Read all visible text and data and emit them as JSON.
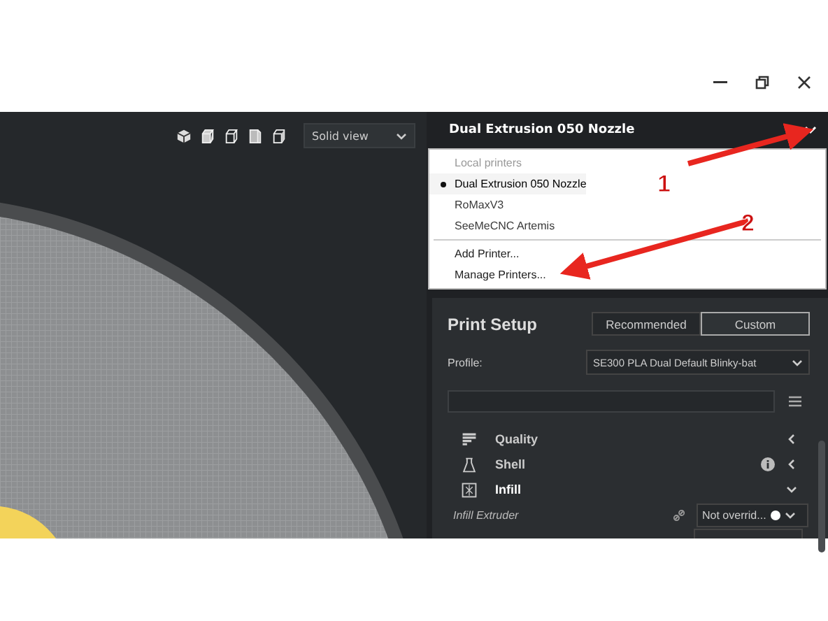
{
  "viewport": {
    "view_mode": "Solid view"
  },
  "printer_selector": {
    "current": "Dual Extrusion 050 Nozzle",
    "expanded": true,
    "menu": [
      {
        "kind": "header",
        "label": "Local printers"
      },
      {
        "kind": "printer",
        "label": "Dual Extrusion 050 Nozzle",
        "selected": true
      },
      {
        "kind": "printer",
        "label": "RoMaxV3",
        "selected": false
      },
      {
        "kind": "printer",
        "label": "SeeMeCNC Artemis",
        "selected": false
      },
      {
        "kind": "divider"
      },
      {
        "kind": "action",
        "label": "Add Printer..."
      },
      {
        "kind": "action",
        "label": "Manage Printers..."
      }
    ]
  },
  "annotations": [
    {
      "label": "1"
    },
    {
      "label": "2"
    }
  ],
  "print_setup": {
    "title": "Print Setup",
    "tabs": [
      {
        "label": "Recommended",
        "selected": false
      },
      {
        "label": "Custom",
        "selected": true
      }
    ],
    "profile_label": "Profile:",
    "profile_value": "SE300 PLA Dual Default Blinky-bat",
    "categories": [
      {
        "label": "Quality",
        "info": false,
        "expanded": false
      },
      {
        "label": "Shell",
        "info": true,
        "expanded": false
      },
      {
        "label": "Infill",
        "info": false,
        "expanded": true
      }
    ],
    "settings": [
      {
        "label": "Infill Extruder",
        "value": "Not overrid..."
      }
    ]
  }
}
